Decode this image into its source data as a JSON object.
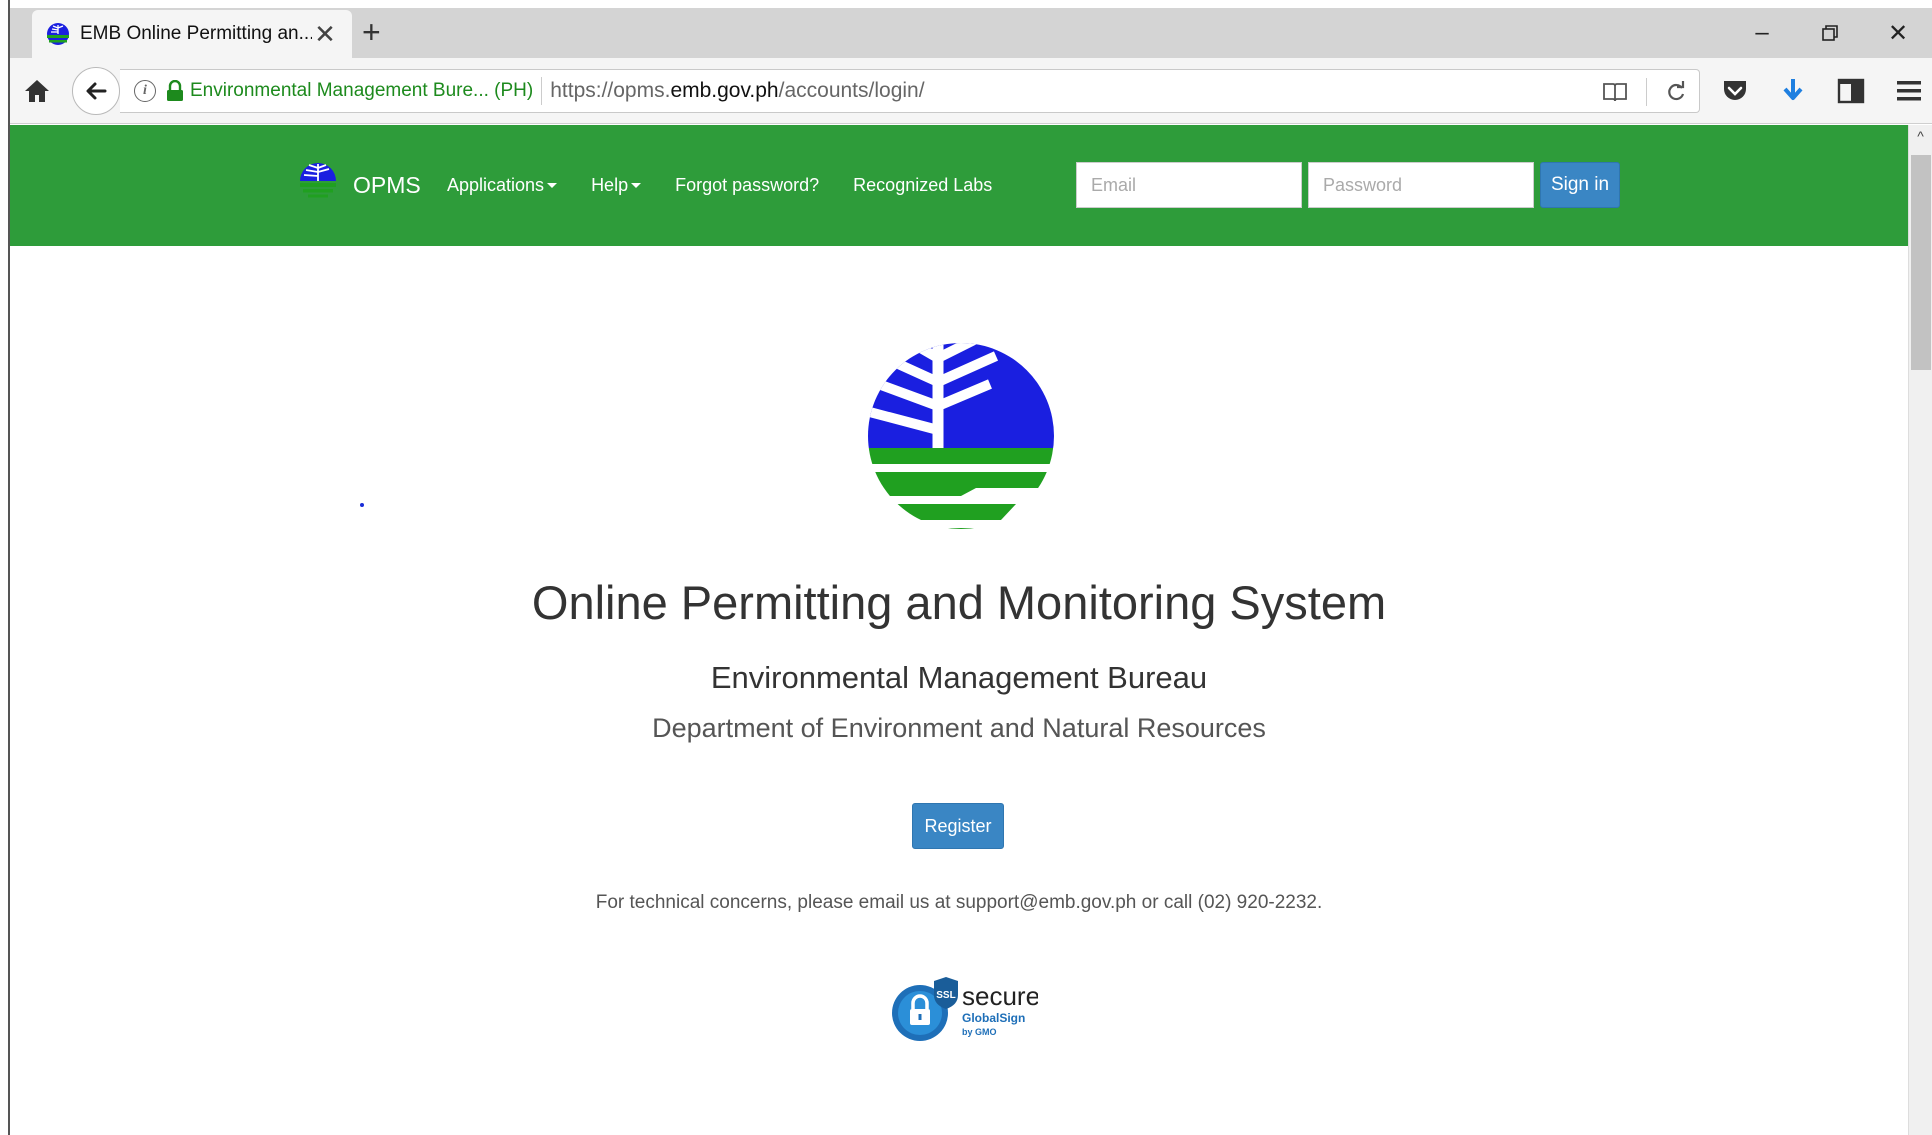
{
  "browser": {
    "tab_title": "EMB Online Permitting an...",
    "site_identity": "Environmental Management Bure... (PH)",
    "url_prefix": "https://opms.",
    "url_domain": "emb.gov.ph",
    "url_path": "/accounts/login/"
  },
  "nav": {
    "brand": "OPMS",
    "items": [
      {
        "label": "Applications",
        "dropdown": true
      },
      {
        "label": "Help",
        "dropdown": true
      },
      {
        "label": "Forgot password?"
      },
      {
        "label": "Recognized Labs"
      }
    ],
    "email_placeholder": "Email",
    "password_placeholder": "Password",
    "signin_label": "Sign in"
  },
  "hero": {
    "title": "Online Permitting and Monitoring System",
    "subtitle": "Environmental Management Bureau",
    "department": "Department of Environment and Natural Resources",
    "register_label": "Register",
    "support_text": "For technical concerns, please email us at support@emb.gov.ph or call (02) 920-2232."
  },
  "badge": {
    "ssl_text": "SSL",
    "secure_text": "secure",
    "issuer": "GlobalSign",
    "by": "by GMO"
  },
  "colors": {
    "nav_green": "#2e9c3a",
    "button_blue": "#3a86c4",
    "logo_blue": "#1a1fe0",
    "logo_green": "#20a020"
  }
}
